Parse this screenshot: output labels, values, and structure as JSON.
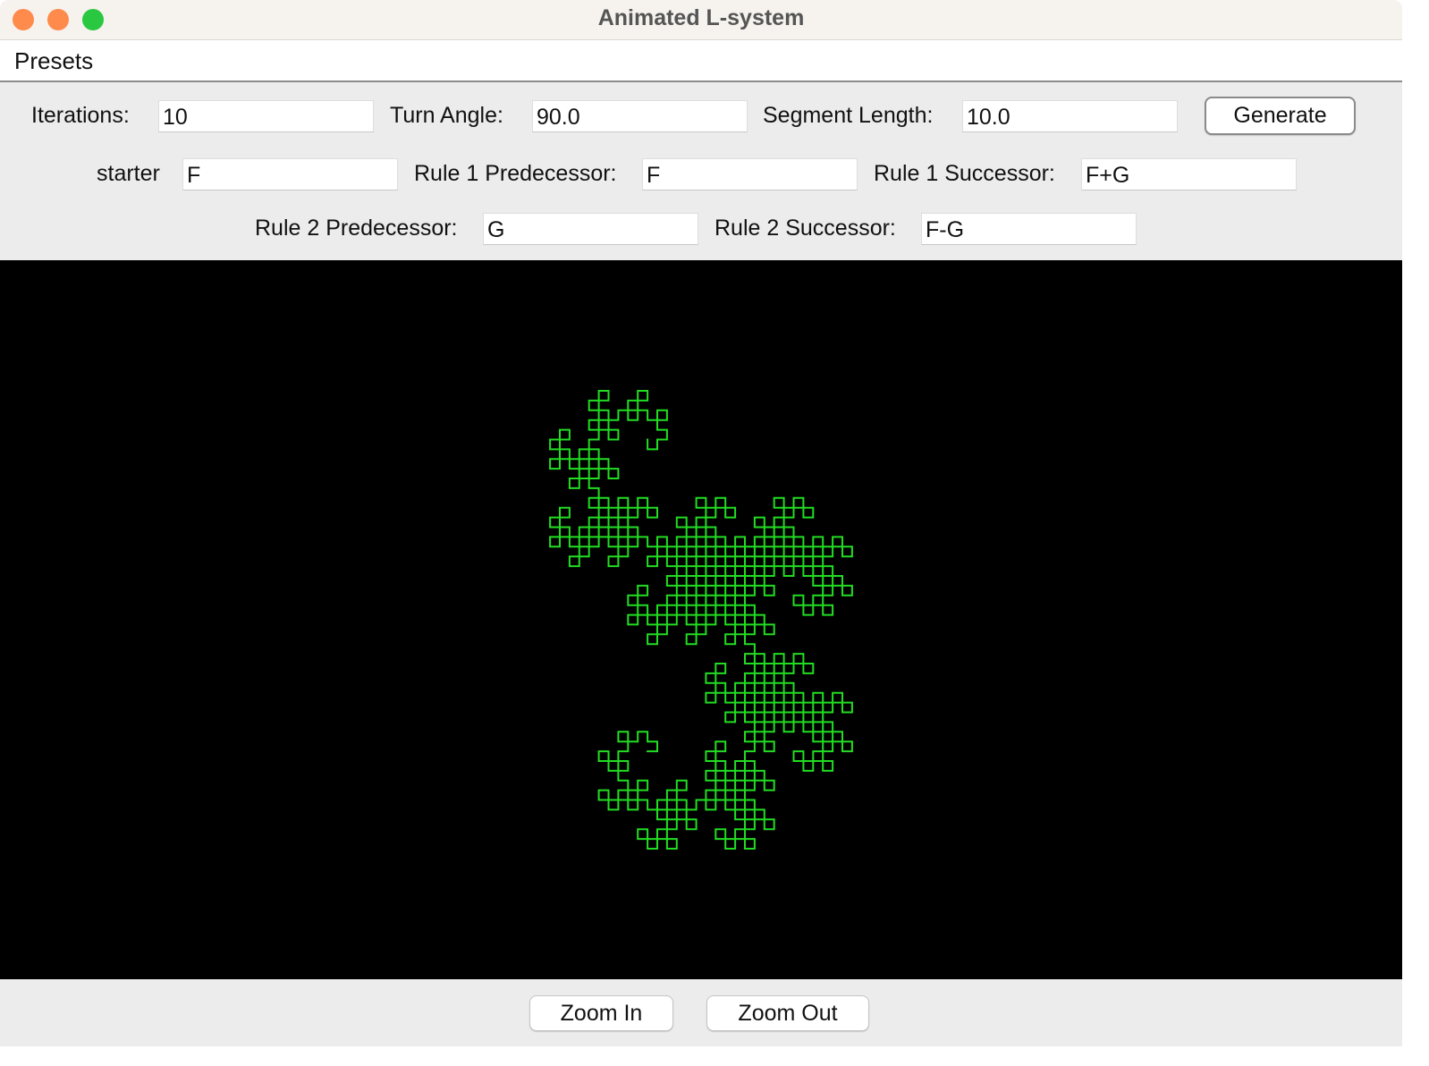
{
  "window": {
    "title": "Animated L-system"
  },
  "menubar": {
    "items": [
      "Presets"
    ]
  },
  "controls": {
    "iterations": {
      "label": "Iterations:",
      "value": "10"
    },
    "turn_angle": {
      "label": "Turn Angle:",
      "value": "90.0"
    },
    "segment_length": {
      "label": "Segment Length:",
      "value": "10.0"
    },
    "generate_label": "Generate",
    "starter": {
      "label": "starter",
      "value": "F"
    },
    "rule1_predecessor": {
      "label": "Rule 1 Predecessor:",
      "value": "F"
    },
    "rule1_successor": {
      "label": "Rule 1 Successor:",
      "value": "F+G"
    },
    "rule2_predecessor": {
      "label": "Rule 2 Predecessor:",
      "value": "G"
    },
    "rule2_successor": {
      "label": "Rule 2 Successor:",
      "value": "F-G"
    }
  },
  "canvas": {
    "background": "#000000",
    "stroke_color": "#22dd22"
  },
  "footer": {
    "zoom_in_label": "Zoom In",
    "zoom_out_label": "Zoom Out"
  }
}
